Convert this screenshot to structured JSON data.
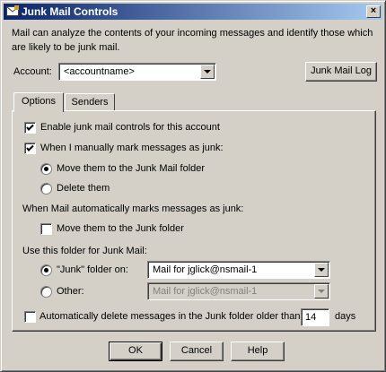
{
  "window": {
    "title": "Junk Mail Controls",
    "close_glyph": "×"
  },
  "intro": "Mail can analyze the contents of your incoming messages and identify those which are likely to be junk mail.",
  "account": {
    "label": "Account:",
    "value": "<accountname>"
  },
  "junk_mail_log_label": "Junk Mail Log",
  "tabs": [
    {
      "label": "Options",
      "active": true
    },
    {
      "label": "Senders",
      "active": false
    }
  ],
  "options": {
    "enable_junk": {
      "label": "Enable junk mail controls for this account",
      "checked": true
    },
    "manual_mark": {
      "label": "When I manually mark messages as junk:",
      "checked": true
    },
    "move_to_junk_mail_folder": {
      "label": "Move them to the Junk Mail folder",
      "selected": true
    },
    "delete_them": {
      "label": "Delete them",
      "selected": false
    },
    "auto_mark_heading": "When Mail automatically marks messages as junk:",
    "auto_move": {
      "label": "Move them to the Junk folder",
      "checked": false
    },
    "folder_heading": "Use this folder for Junk Mail:",
    "junk_folder_on": {
      "label": "\"Junk\" folder on:",
      "selected": true,
      "value": "Mail for jglick@nsmail-1"
    },
    "other": {
      "label": "Other:",
      "selected": false,
      "value": "Mail for jglick@nsmail-1"
    },
    "auto_delete": {
      "label_prefix": "Automatically delete messages in the Junk folder older than",
      "days_value": "14",
      "days_label": "days",
      "checked": false
    }
  },
  "buttons": {
    "ok": "OK",
    "cancel": "Cancel",
    "help": "Help"
  },
  "colors": {
    "titlebar_start": "#0a246a",
    "titlebar_end": "#a6caf0",
    "face": "#d4d0c8"
  }
}
